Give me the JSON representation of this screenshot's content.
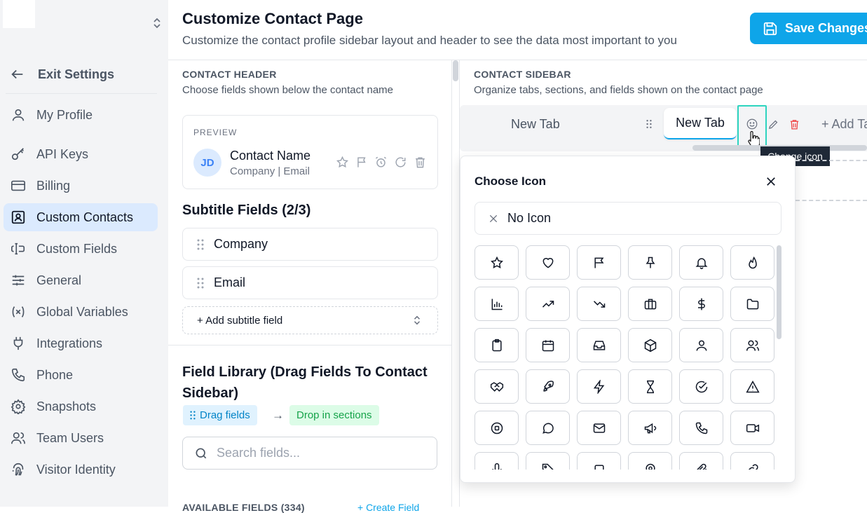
{
  "sidebar": {
    "exit_label": "Exit Settings",
    "items": [
      {
        "label": "My Profile",
        "icon": "user-icon"
      },
      {
        "label": "API Keys",
        "icon": "key-icon"
      },
      {
        "label": "Billing",
        "icon": "credit-card-icon"
      },
      {
        "label": "Custom Contacts",
        "icon": "contact-card-icon",
        "active": true
      },
      {
        "label": "Custom Fields",
        "icon": "text-cursor-icon"
      },
      {
        "label": "General",
        "icon": "sliders-icon"
      },
      {
        "label": "Global Variables",
        "icon": "variable-icon"
      },
      {
        "label": "Integrations",
        "icon": "plug-icon"
      },
      {
        "label": "Phone",
        "icon": "phone-icon"
      },
      {
        "label": "Snapshots",
        "icon": "gear-icon"
      },
      {
        "label": "Team Users",
        "icon": "users-icon"
      },
      {
        "label": "Visitor Identity",
        "icon": "fingerprint-icon"
      }
    ]
  },
  "header": {
    "title": "Customize Contact Page",
    "subtitle": "Customize the contact profile sidebar layout and header to see the data most important to you",
    "save_label": "Save Changes"
  },
  "contact_header": {
    "heading": "CONTACT HEADER",
    "description": "Choose fields shown below the contact name",
    "preview_label": "PREVIEW",
    "avatar_initials": "JD",
    "contact_name": "Contact Name",
    "contact_sub": "Company | Email",
    "subtitle_heading": "Subtitle Fields (2/3)",
    "subtitle_fields": [
      "Company",
      "Email"
    ],
    "add_subtitle_label": "+ Add subtitle field"
  },
  "field_library": {
    "heading": "Field Library (Drag Fields To Contact Sidebar)",
    "drag_tag": "Drag fields",
    "arrow": "→",
    "drop_tag": "Drop in sections",
    "search_placeholder": "Search fields...",
    "available_label": "AVAILABLE FIELDS (334)",
    "create_label": "+ Create Field"
  },
  "contact_sidebar": {
    "heading": "CONTACT SIDEBAR",
    "description": "Organize tabs, sections, and fields shown on the contact page",
    "tabs": [
      "New Tab",
      "New Tab"
    ],
    "add_tab_label": "+ Add Tab",
    "tooltip": "Change icon"
  },
  "icon_picker": {
    "title": "Choose Icon",
    "no_icon_label": "No Icon",
    "icons": [
      "star-icon",
      "heart-icon",
      "flag-icon",
      "pin-icon",
      "bell-icon",
      "flame-icon",
      "bar-chart-icon",
      "trending-up-icon",
      "trending-down-icon",
      "briefcase-icon",
      "dollar-icon",
      "folder-icon",
      "clipboard-icon",
      "calendar-icon",
      "inbox-icon",
      "package-icon",
      "user-icon",
      "users-icon",
      "handshake-icon",
      "rocket-icon",
      "zap-icon",
      "hourglass-icon",
      "check-circle-icon",
      "alert-triangle-icon",
      "target-icon",
      "message-circle-icon",
      "mail-icon",
      "megaphone-icon",
      "phone-icon",
      "video-icon",
      "mic-icon",
      "tag-icon",
      "square-icon",
      "map-pin-icon",
      "paperclip-icon",
      "link-icon"
    ]
  },
  "colors": {
    "accent": "#0ea5e9",
    "active_nav": "#dbeafe",
    "highlight": "#2dd4bf",
    "danger": "#ef4444"
  }
}
